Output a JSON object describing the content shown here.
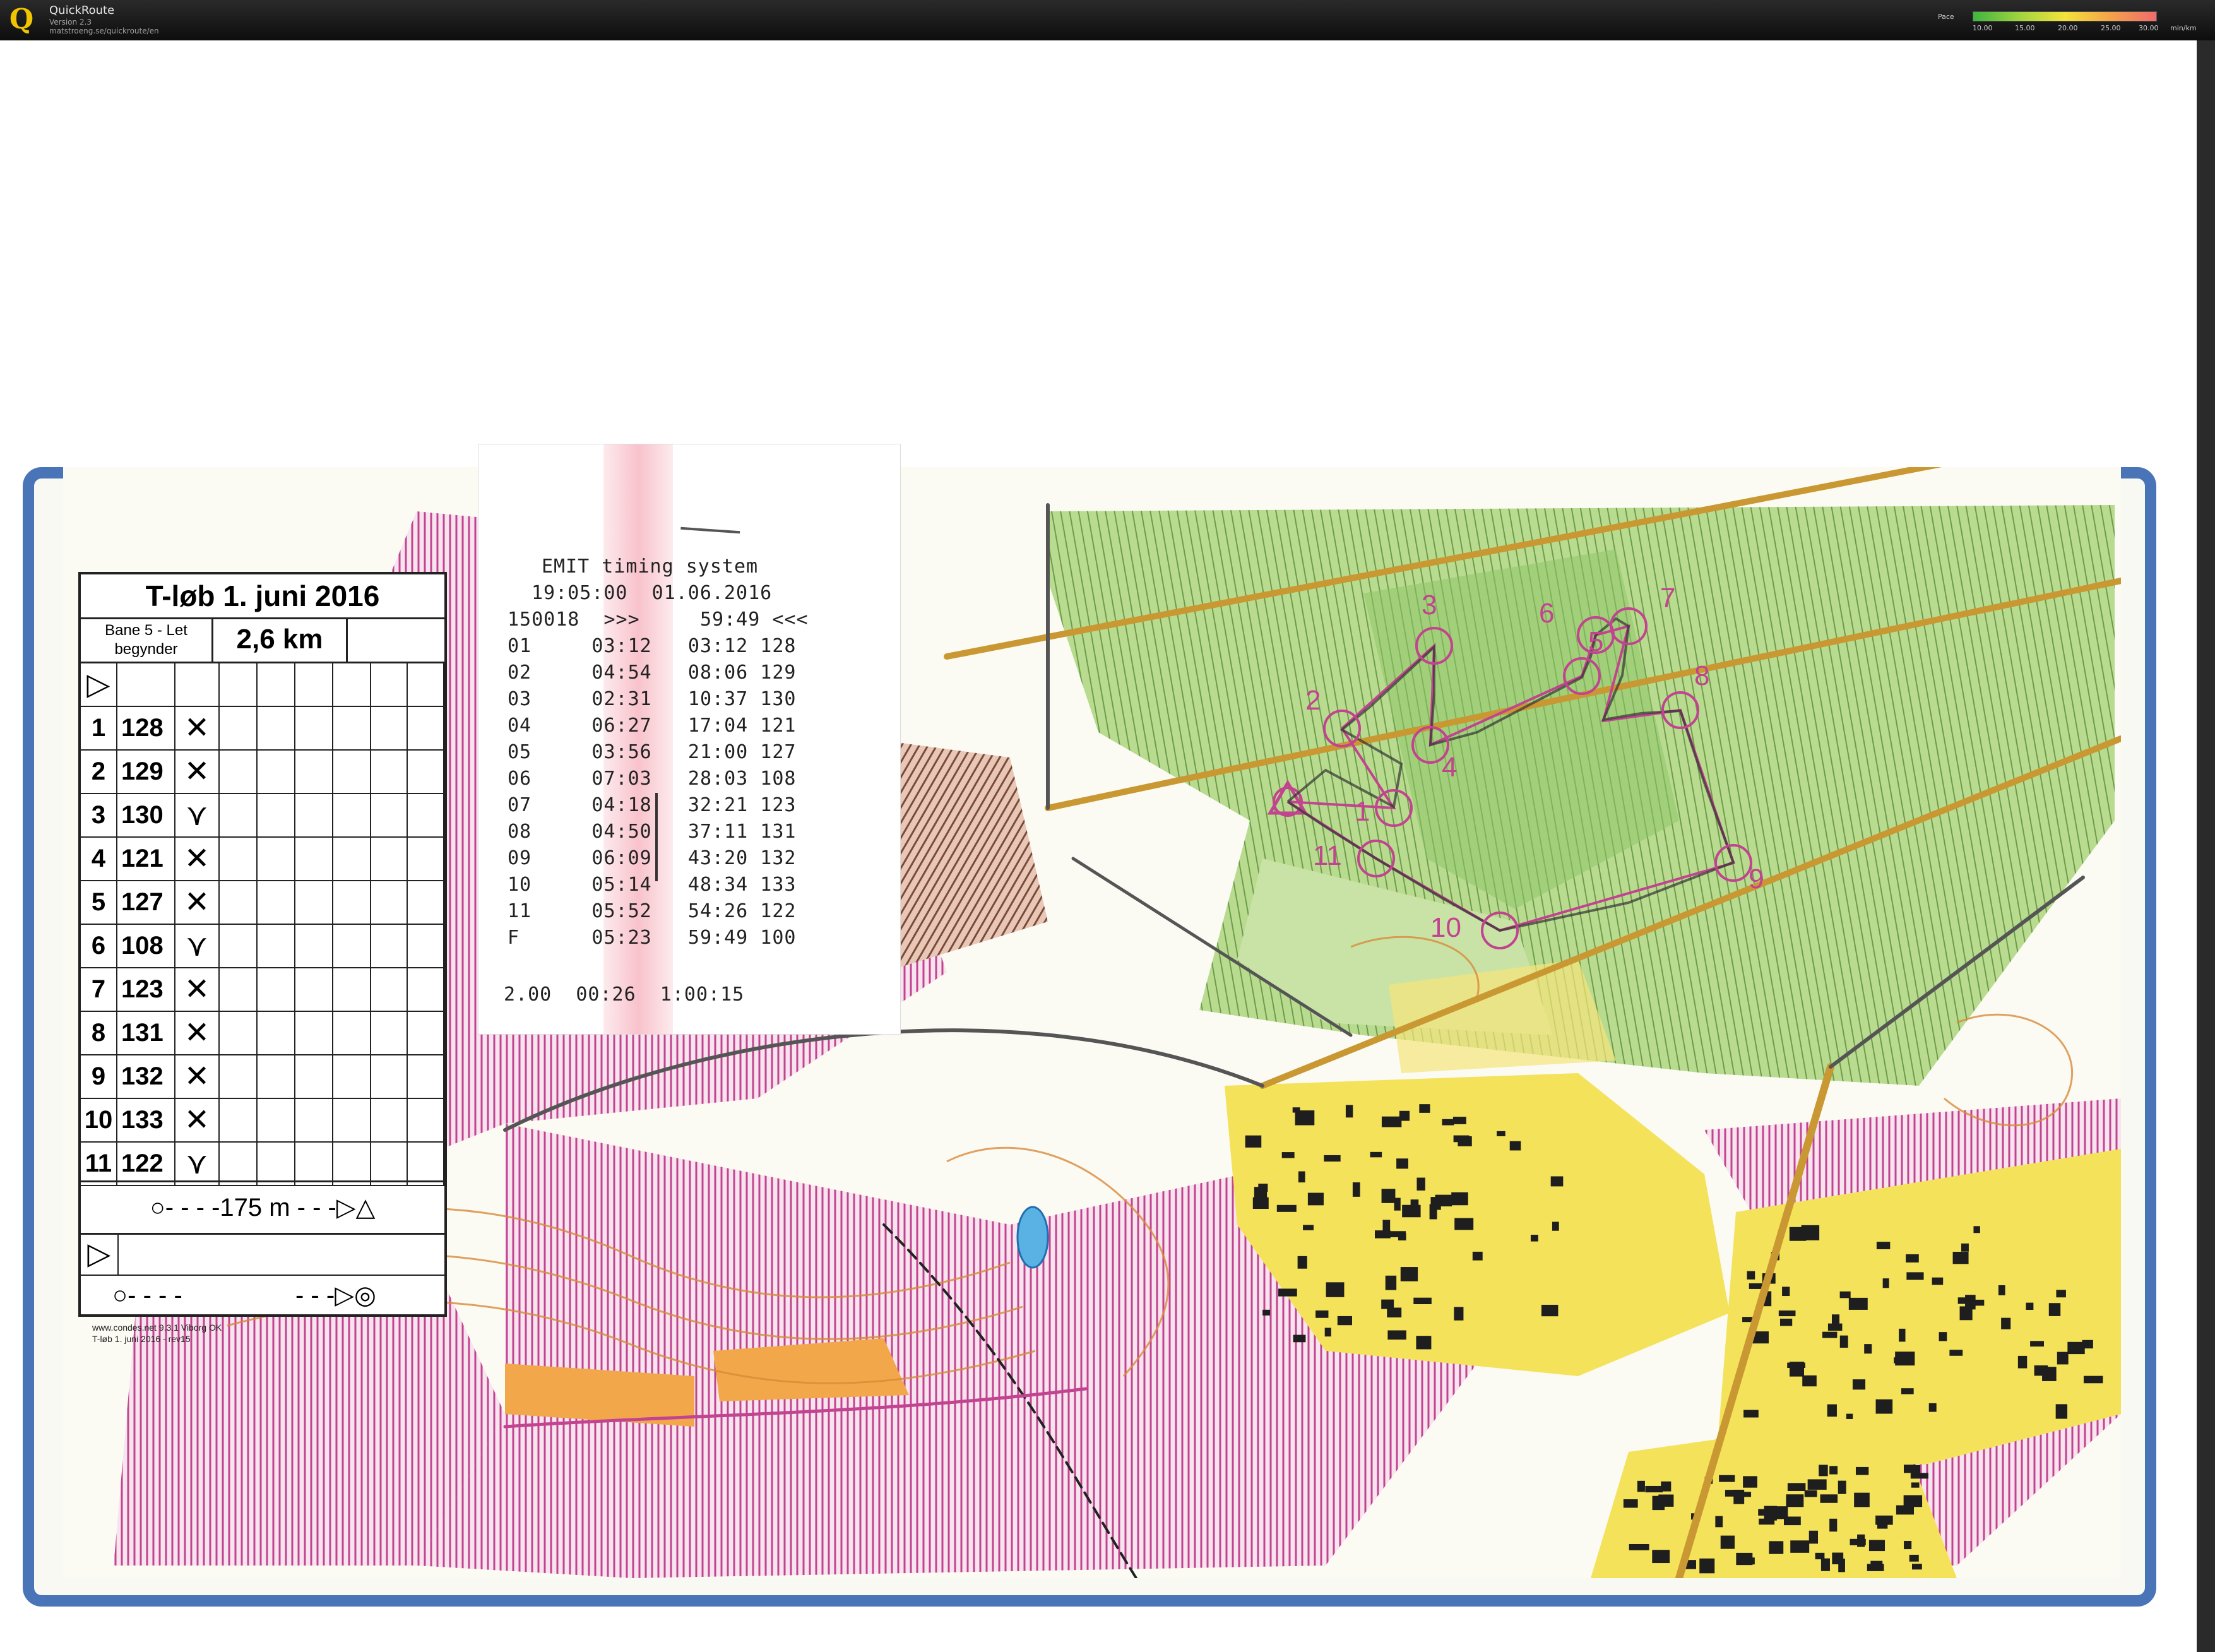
{
  "app": {
    "name": "QuickRoute",
    "version": "Version 2.3",
    "url": "matstroeng.se/quickroute/en",
    "logo_letter": "Q"
  },
  "pace_legend": {
    "label": "Pace",
    "ticks": [
      "10.00",
      "15.00",
      "20.00",
      "25.00",
      "30.00"
    ],
    "unit": "min/km",
    "colors": [
      "#3fb53f",
      "#9fd43f",
      "#f2e33a",
      "#f5a24a",
      "#f06b6b"
    ]
  },
  "control_card": {
    "title": "T-løb 1. juni 2016",
    "course_line1": "Bane 5 - Let",
    "course_line2": "begynder",
    "length": "2,6 km",
    "start_symbol": "▷",
    "rows": [
      {
        "num": "1",
        "code": "128",
        "mark": "✕"
      },
      {
        "num": "2",
        "code": "129",
        "mark": "✕"
      },
      {
        "num": "3",
        "code": "130",
        "mark": "⋎"
      },
      {
        "num": "4",
        "code": "121",
        "mark": "✕"
      },
      {
        "num": "5",
        "code": "127",
        "mark": "✕"
      },
      {
        "num": "6",
        "code": "108",
        "mark": "⋎"
      },
      {
        "num": "7",
        "code": "123",
        "mark": "✕"
      },
      {
        "num": "8",
        "code": "131",
        "mark": "✕"
      },
      {
        "num": "9",
        "code": "132",
        "mark": "✕"
      },
      {
        "num": "10",
        "code": "133",
        "mark": "✕"
      },
      {
        "num": "11",
        "code": "122",
        "mark": "⋎"
      }
    ],
    "taping": "○- - - -175 m - - -▷△",
    "finish_symbol": "▷",
    "finish_tape_left": "○- - - -",
    "finish_tape_right": "- - -▷◎",
    "footer_line1": "www.condes.net 9.3.1 Viborg OK",
    "footer_line2": "T-løb 1. juni 2016 - rev15"
  },
  "receipt": {
    "title": "EMIT timing system",
    "datetime": "19:05:00  01.06.2016",
    "header": "150018  >>>     59:49 <<<",
    "lines": [
      "01     03:12   03:12 128",
      "02     04:54   08:06 129",
      "03     02:31   10:37 130",
      "04     06:27   17:04 121",
      "05     03:56   21:00 127",
      "06     07:03   28:03 108",
      "07     04:18   32:21 123",
      "08     04:50   37:11 131",
      "09     06:09   43:20 132",
      "10     05:14   48:34 133",
      "11     05:52   54:26 122",
      "F      05:23   59:49 100"
    ],
    "summary": "2.00  00:26  1:00:15"
  },
  "map": {
    "control_labels": [
      "1",
      "2",
      "3",
      "4",
      "5",
      "6",
      "7",
      "8",
      "9",
      "10",
      "11"
    ],
    "colors": {
      "frame": "#4a74b8",
      "forest_green": "#b9db8f",
      "dark_green": "#8fc46a",
      "open_yellow": "#f5e47a",
      "urban_yellow": "#f3e25a",
      "purple_hatch": "#c2438f",
      "course": "#c2438f",
      "road": "#c99832",
      "building": "#1e1e1e",
      "contour": "#d98a3a"
    }
  }
}
